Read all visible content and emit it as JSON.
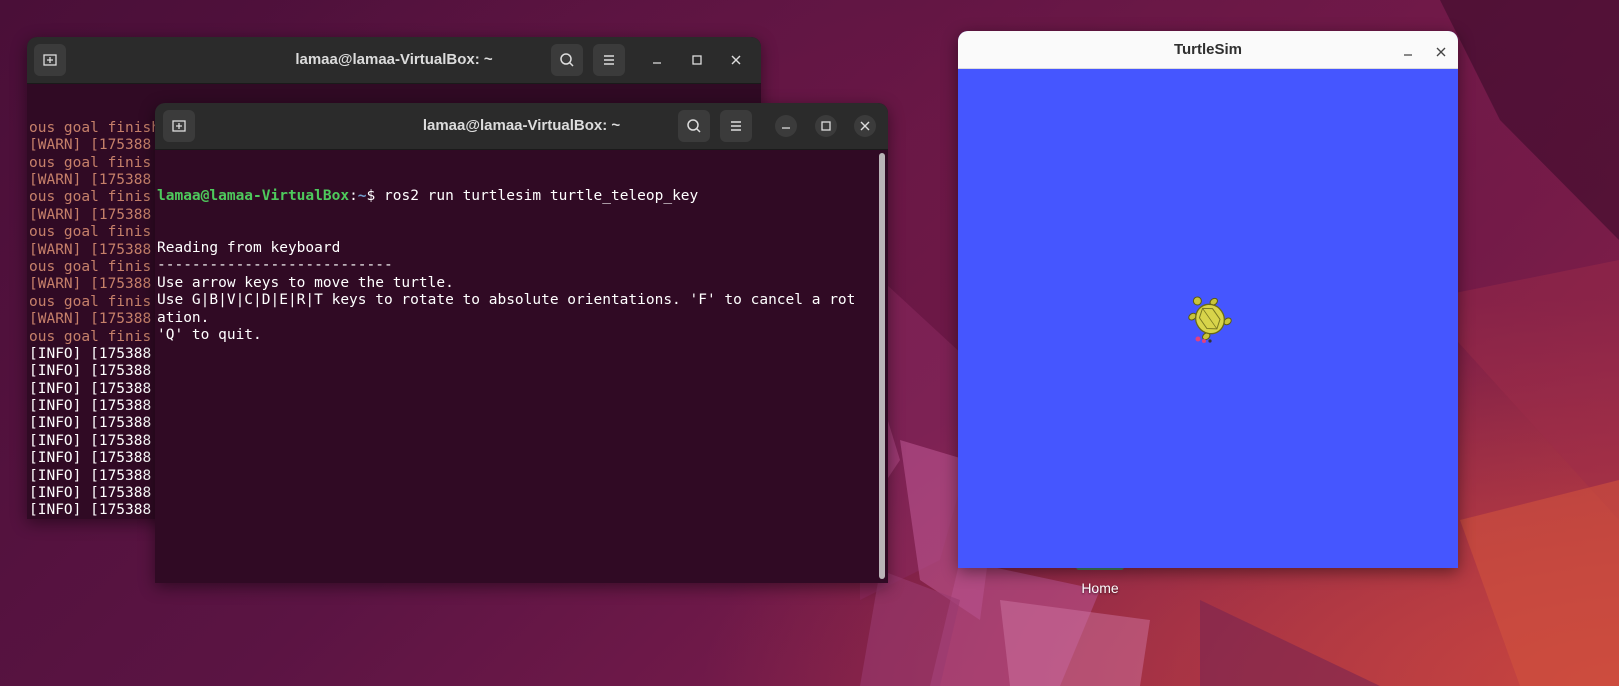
{
  "desktop": {
    "home_icon_label": "Home"
  },
  "terminal_back": {
    "title": "lamaa@lamaa-VirtualBox: ~",
    "lines": [
      {
        "text": "ous goal finished. Aborting previous goal",
        "kind": "warn"
      },
      {
        "text": "[WARN] [175388",
        "kind": "warn"
      },
      {
        "text": "ous goal finis",
        "kind": "warn"
      },
      {
        "text": "[WARN] [175388",
        "kind": "warn"
      },
      {
        "text": "ous goal finis",
        "kind": "warn"
      },
      {
        "text": "[WARN] [175388",
        "kind": "warn"
      },
      {
        "text": "ous goal finis",
        "kind": "warn"
      },
      {
        "text": "[WARN] [175388",
        "kind": "warn"
      },
      {
        "text": "ous goal finis",
        "kind": "warn"
      },
      {
        "text": "[WARN] [175388",
        "kind": "warn"
      },
      {
        "text": "ous goal finis",
        "kind": "warn"
      },
      {
        "text": "[WARN] [175388",
        "kind": "warn"
      },
      {
        "text": "ous goal finis",
        "kind": "warn"
      },
      {
        "text": "[INFO] [175388",
        "kind": "ok"
      },
      {
        "text": "[INFO] [175388",
        "kind": "ok"
      },
      {
        "text": "[INFO] [175388",
        "kind": "ok"
      },
      {
        "text": "[INFO] [175388",
        "kind": "ok"
      },
      {
        "text": "[INFO] [175388",
        "kind": "ok"
      },
      {
        "text": "[INFO] [175388",
        "kind": "ok"
      },
      {
        "text": "[INFO] [175388",
        "kind": "ok"
      },
      {
        "text": "[INFO] [175388",
        "kind": "ok"
      },
      {
        "text": "[INFO] [175388",
        "kind": "ok"
      },
      {
        "text": "[INFO] [175388",
        "kind": "ok"
      }
    ]
  },
  "terminal_front": {
    "title": "lamaa@lamaa-VirtualBox: ~",
    "prompt_user": "lamaa@lamaa-VirtualBox",
    "prompt_sep": ":",
    "prompt_path": "~",
    "prompt_symbol": "$ ",
    "command": "ros2 run turtlesim turtle_teleop_key",
    "output": [
      "Reading from keyboard",
      "---------------------------",
      "Use arrow keys to move the turtle.",
      "Use G|B|V|C|D|E|R|T keys to rotate to absolute orientations. 'F' to cancel a rot",
      "ation.",
      "'Q' to quit."
    ]
  },
  "turtlesim": {
    "title": "TurtleSim",
    "background_color": "#4556ff",
    "turtle_color": "#c8c43a"
  },
  "icons": {
    "new_tab": "new-tab-icon",
    "search": "search-icon",
    "menu": "hamburger-menu-icon",
    "minimize": "minimize-icon",
    "maximize": "maximize-icon",
    "close": "close-icon"
  }
}
